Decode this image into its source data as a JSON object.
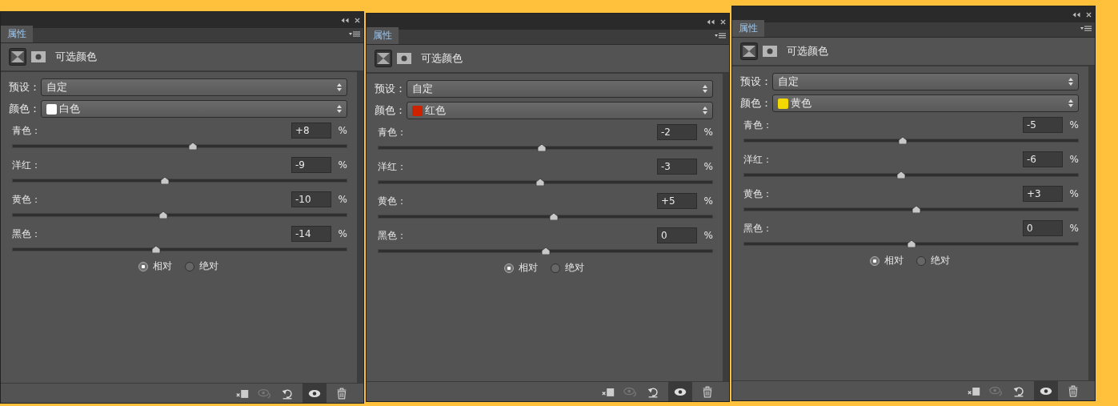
{
  "panels": [
    {
      "tab": {
        "label": "属性",
        "selected": true
      },
      "title": "可选颜色",
      "preset": {
        "label": "预设：",
        "value": "自定"
      },
      "color": {
        "label": "颜色：",
        "value": "白色",
        "color": "#ffffff"
      },
      "sliders": [
        {
          "name": "青色：",
          "value": "+8",
          "unit": "%",
          "level": 0.54
        },
        {
          "name": "洋红：",
          "value": "-9",
          "unit": "%",
          "level": 0.455
        },
        {
          "name": "黄色：",
          "value": "-10",
          "unit": "%",
          "level": 0.45
        },
        {
          "name": "黑色：",
          "value": "-14",
          "unit": "%",
          "level": 0.43
        }
      ],
      "modes": [
        {
          "label": "相对",
          "selected": true
        },
        {
          "label": "绝对",
          "selected": false
        }
      ],
      "layer_visible": true
    },
    {
      "tab": {
        "label": "属性",
        "selected": true
      },
      "title": "可选颜色",
      "preset": {
        "label": "预设：",
        "value": "自定"
      },
      "color": {
        "label": "颜色：",
        "value": "红色",
        "color": "#cc2200"
      },
      "sliders": [
        {
          "name": "青色：",
          "value": "-2",
          "unit": "%",
          "level": 0.49
        },
        {
          "name": "洋红：",
          "value": "-3",
          "unit": "%",
          "level": 0.485
        },
        {
          "name": "黄色：",
          "value": "+5",
          "unit": "%",
          "level": 0.525
        },
        {
          "name": "黑色：",
          "value": "0",
          "unit": "%",
          "level": 0.5
        }
      ],
      "modes": [
        {
          "label": "相对",
          "selected": true
        },
        {
          "label": "绝对",
          "selected": false
        }
      ],
      "layer_visible": true
    },
    {
      "tab": {
        "label": "属性",
        "selected": true
      },
      "title": "可选颜色",
      "preset": {
        "label": "预设：",
        "value": "自定"
      },
      "color": {
        "label": "颜色：",
        "value": "黄色",
        "color": "#f2d800"
      },
      "sliders": [
        {
          "name": "青色：",
          "value": "-5",
          "unit": "%",
          "level": 0.475
        },
        {
          "name": "洋红：",
          "value": "-6",
          "unit": "%",
          "level": 0.47
        },
        {
          "name": "黄色：",
          "value": "+3",
          "unit": "%",
          "level": 0.515
        },
        {
          "name": "黑色：",
          "value": "0",
          "unit": "%",
          "level": 0.5
        }
      ],
      "modes": [
        {
          "label": "相对",
          "selected": true
        },
        {
          "label": "绝对",
          "selected": false
        }
      ],
      "layer_visible": true
    }
  ]
}
